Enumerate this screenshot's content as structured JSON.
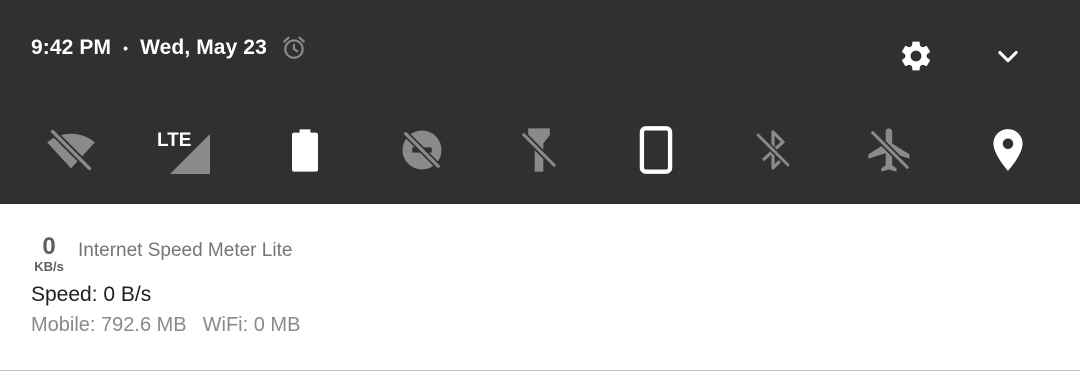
{
  "status": {
    "time": "9:42 PM",
    "separator": "•",
    "date": "Wed, May 23",
    "alarm_icon": "alarm-icon"
  },
  "header": {
    "settings_icon": "settings-gear-icon",
    "expand_icon": "chevron-down-icon"
  },
  "quick_settings": [
    {
      "name": "wifi-off",
      "icon": "wifi-off-icon",
      "state": "off"
    },
    {
      "name": "mobile-data",
      "icon": "cell-signal-icon",
      "label": "LTE",
      "state": "on"
    },
    {
      "name": "battery",
      "icon": "battery-icon",
      "state": "on"
    },
    {
      "name": "data-saver",
      "icon": "data-saver-off-icon",
      "state": "off"
    },
    {
      "name": "flashlight",
      "icon": "flashlight-off-icon",
      "state": "off"
    },
    {
      "name": "auto-rotate",
      "icon": "portrait-phone-icon",
      "state": "on"
    },
    {
      "name": "bluetooth",
      "icon": "bluetooth-off-icon",
      "state": "off"
    },
    {
      "name": "airplane-mode",
      "icon": "airplane-off-icon",
      "state": "off"
    },
    {
      "name": "location",
      "icon": "location-pin-icon",
      "state": "on"
    }
  ],
  "notification": {
    "meter_value": "0",
    "meter_unit": "KB/s",
    "app_name": "Internet Speed Meter Lite",
    "speed": "Speed: 0 B/s",
    "mobile_usage": "Mobile: 792.6 MB",
    "wifi_usage": "WiFi: 0 MB"
  },
  "colors": {
    "shade_background": "#303030",
    "icon_on": "#ffffff",
    "icon_off": "#8a8a8a",
    "notification_background": "#ffffff"
  }
}
